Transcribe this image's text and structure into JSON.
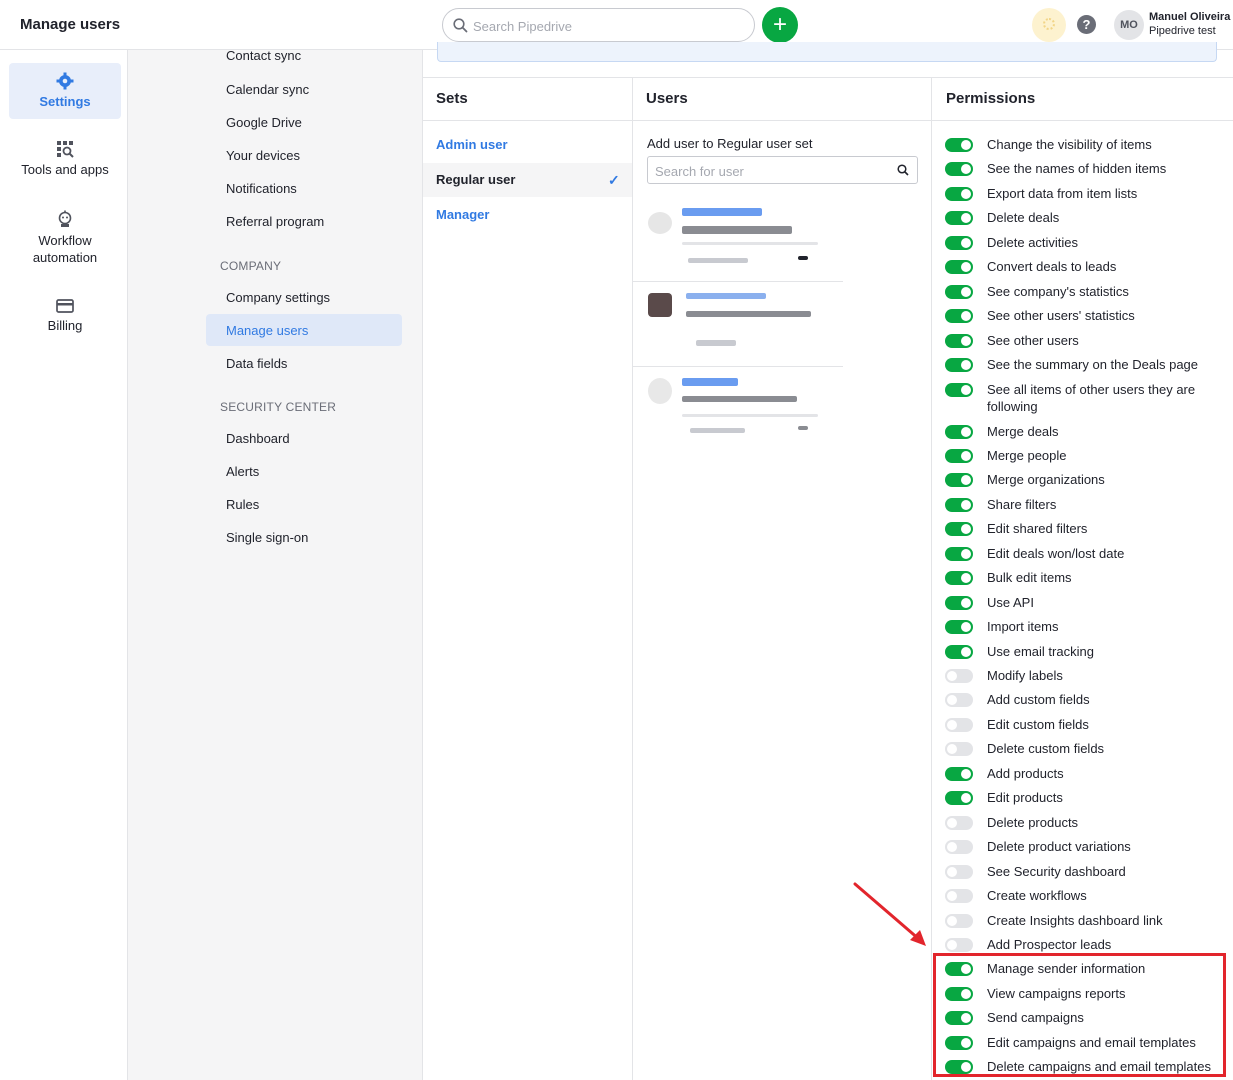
{
  "header": {
    "title": "Manage users",
    "search_placeholder": "Search Pipedrive",
    "add_label": "+",
    "help_label": "?",
    "avatar_initials": "MO",
    "user_name": "Manuel Oliveira",
    "user_company": "Pipedrive test"
  },
  "leftnav": [
    {
      "label": "Settings",
      "icon": "gear-icon",
      "active": true
    },
    {
      "label": "Tools and apps",
      "icon": "tools-icon",
      "active": false
    },
    {
      "label": "Workflow automation",
      "icon": "robot-icon",
      "active": false
    },
    {
      "label": "Billing",
      "icon": "credit-card-icon",
      "active": false
    }
  ],
  "subnav": {
    "personal": [
      "Contact sync",
      "Calendar sync",
      "Google Drive",
      "Your devices",
      "Notifications",
      "Referral program"
    ],
    "company_heading": "COMPANY",
    "company": [
      "Company settings",
      "Manage users",
      "Data fields"
    ],
    "security_heading": "SECURITY CENTER",
    "security": [
      "Dashboard",
      "Alerts",
      "Rules",
      "Single sign-on"
    ]
  },
  "columns": {
    "sets": "Sets",
    "users": "Users",
    "permissions": "Permissions"
  },
  "sets": [
    "Admin user",
    "Regular user",
    "Manager"
  ],
  "selected_set": "Regular user",
  "users_panel": {
    "add_label": "Add user to Regular user set",
    "search_placeholder": "Search for user"
  },
  "permissions": [
    {
      "label": "Change the visibility of items",
      "on": true
    },
    {
      "label": "See the names of hidden items",
      "on": true
    },
    {
      "label": "Export data from item lists",
      "on": true
    },
    {
      "label": "Delete deals",
      "on": true
    },
    {
      "label": "Delete activities",
      "on": true
    },
    {
      "label": "Convert deals to leads",
      "on": true
    },
    {
      "label": "See company's statistics",
      "on": true
    },
    {
      "label": "See other users' statistics",
      "on": true
    },
    {
      "label": "See other users",
      "on": true
    },
    {
      "label": "See the summary on the Deals page",
      "on": true
    },
    {
      "label": "See all items of other users they are following",
      "on": true
    },
    {
      "label": "Merge deals",
      "on": true
    },
    {
      "label": "Merge people",
      "on": true
    },
    {
      "label": "Merge organizations",
      "on": true
    },
    {
      "label": "Share filters",
      "on": true
    },
    {
      "label": "Edit shared filters",
      "on": true
    },
    {
      "label": "Edit deals won/lost date",
      "on": true
    },
    {
      "label": "Bulk edit items",
      "on": true
    },
    {
      "label": "Use API",
      "on": true
    },
    {
      "label": "Import items",
      "on": true
    },
    {
      "label": "Use email tracking",
      "on": true
    },
    {
      "label": "Modify labels",
      "on": false
    },
    {
      "label": "Add custom fields",
      "on": false
    },
    {
      "label": "Edit custom fields",
      "on": false
    },
    {
      "label": "Delete custom fields",
      "on": false
    },
    {
      "label": "Add products",
      "on": true
    },
    {
      "label": "Edit products",
      "on": true
    },
    {
      "label": "Delete products",
      "on": false
    },
    {
      "label": "Delete product variations",
      "on": false
    },
    {
      "label": "See Security dashboard",
      "on": false
    },
    {
      "label": "Create workflows",
      "on": false
    },
    {
      "label": "Create Insights dashboard link",
      "on": false
    },
    {
      "label": "Add Prospector leads",
      "on": false
    },
    {
      "label": "Manage sender information",
      "on": true
    },
    {
      "label": "View campaigns reports",
      "on": true
    },
    {
      "label": "Send campaigns",
      "on": true
    },
    {
      "label": "Edit campaigns and email templates",
      "on": true
    },
    {
      "label": "Delete campaigns and email templates",
      "on": true
    }
  ],
  "colors": {
    "accent": "#317ae2",
    "toggle_on": "#08a742",
    "toggle_off": "#e3e4e7",
    "highlight": "#e2252c"
  }
}
